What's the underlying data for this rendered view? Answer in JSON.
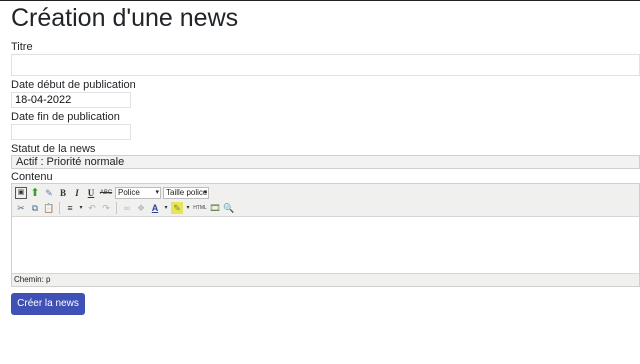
{
  "page": {
    "title": "Création d'une news"
  },
  "form": {
    "titre_label": "Titre",
    "titre_value": "",
    "date_debut_label": "Date début de publication",
    "date_debut_value": "18-04-2022",
    "date_fin_label": "Date fin de publication",
    "date_fin_value": "",
    "statut_label": "Statut de la news",
    "statut_value": "Actif : Priorité normale",
    "contenu_label": "Contenu"
  },
  "editor": {
    "font_select": "Police",
    "size_select": "Taille police",
    "path_label": "Chemin: p",
    "html_label": "HTML"
  },
  "submit_label": "Créer la news"
}
